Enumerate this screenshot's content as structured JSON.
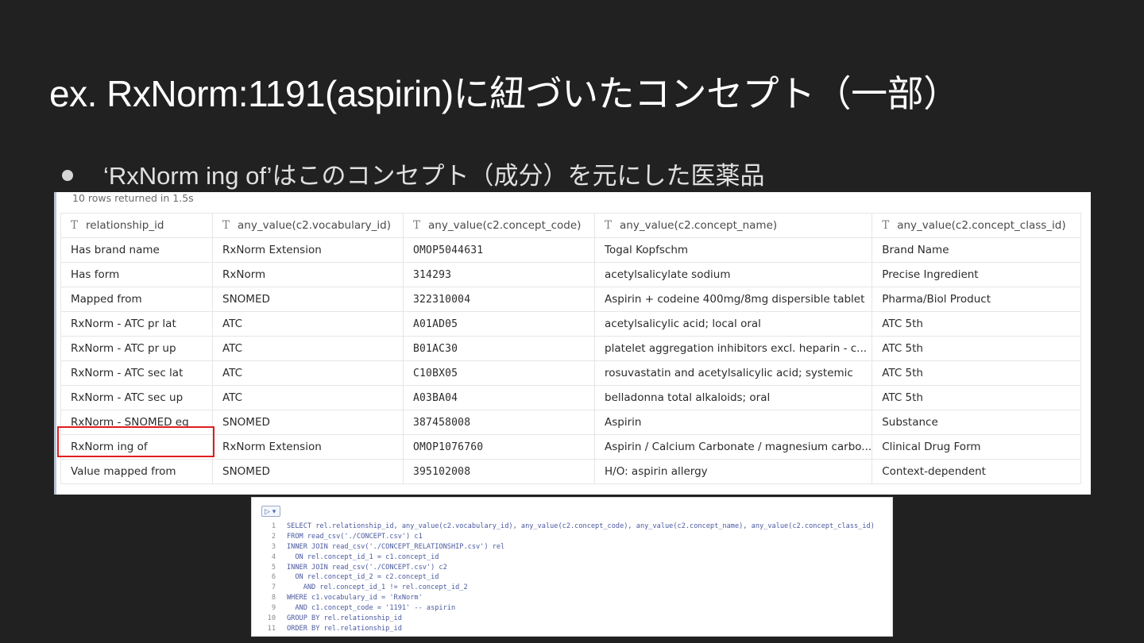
{
  "slide": {
    "title": "ex. RxNorm:1191(aspirin)に紐づいたコンセプト（一部）",
    "bullet": "‘RxNorm ing of’はこのコンセプト（成分）を元にした医薬品"
  },
  "results": {
    "status": "10 rows returned in 1.5s",
    "type_glyph": "T",
    "columns": [
      "relationship_id",
      "any_value(c2.vocabulary_id)",
      "any_value(c2.concept_code)",
      "any_value(c2.concept_name)",
      "any_value(c2.concept_class_id)"
    ],
    "rows": [
      [
        "Has brand name",
        "RxNorm Extension",
        "OMOP5044631",
        "Togal Kopfschm",
        "Brand Name"
      ],
      [
        "Has form",
        "RxNorm",
        "314293",
        "acetylsalicylate sodium",
        "Precise Ingredient"
      ],
      [
        "Mapped from",
        "SNOMED",
        "322310004",
        "Aspirin + codeine 400mg/8mg dispersible tablet",
        "Pharma/Biol Product"
      ],
      [
        "RxNorm - ATC pr lat",
        "ATC",
        "A01AD05",
        "acetylsalicylic acid; local oral",
        "ATC 5th"
      ],
      [
        "RxNorm - ATC pr up",
        "ATC",
        "B01AC30",
        "platelet aggregation inhibitors excl. heparin - c...",
        "ATC 5th"
      ],
      [
        "RxNorm - ATC sec lat",
        "ATC",
        "C10BX05",
        "rosuvastatin and acetylsalicylic acid; systemic",
        "ATC 5th"
      ],
      [
        "RxNorm - ATC sec up",
        "ATC",
        "A03BA04",
        "belladonna total alkaloids; oral",
        "ATC 5th"
      ],
      [
        "RxNorm - SNOMED eq",
        "SNOMED",
        "387458008",
        "Aspirin",
        "Substance"
      ],
      [
        "RxNorm ing of",
        "RxNorm Extension",
        "OMOP1076760",
        "Aspirin / Calcium Carbonate / magnesium carbo...",
        "Clinical Drug Form"
      ],
      [
        "Value mapped from",
        "SNOMED",
        "395102008",
        "H/O: aspirin allergy",
        "Context-dependent"
      ]
    ],
    "highlighted_row": 8,
    "highlight_color": "#e01e1e"
  },
  "editor": {
    "run_label": "▷ ▾",
    "lines": [
      {
        "n": "1",
        "text": "SELECT rel.relationship_id, any_value(c2.vocabulary_id), any_value(c2.concept_code), any_value(c2.concept_name), any_value(c2.concept_class_id)"
      },
      {
        "n": "2",
        "text": "FROM read_csv('./CONCEPT.csv') c1"
      },
      {
        "n": "3",
        "text": "INNER JOIN read_csv('./CONCEPT_RELATIONSHIP.csv') rel"
      },
      {
        "n": "4",
        "text": "  ON rel.concept_id_1 = c1.concept_id"
      },
      {
        "n": "5",
        "text": "INNER JOIN read_csv('./CONCEPT.csv') c2"
      },
      {
        "n": "6",
        "text": "  ON rel.concept_id_2 = c2.concept_id"
      },
      {
        "n": "7",
        "text": "    AND rel.concept_id_1 != rel.concept_id_2"
      },
      {
        "n": "8",
        "text": "WHERE c1.vocabulary_id = 'RxNorm'"
      },
      {
        "n": "9",
        "text": "  AND c1.concept_code = '1191' -- aspirin"
      },
      {
        "n": "10",
        "text": "GROUP BY rel.relationship_id"
      },
      {
        "n": "11",
        "text": "ORDER BY rel.relationship_id"
      }
    ]
  }
}
